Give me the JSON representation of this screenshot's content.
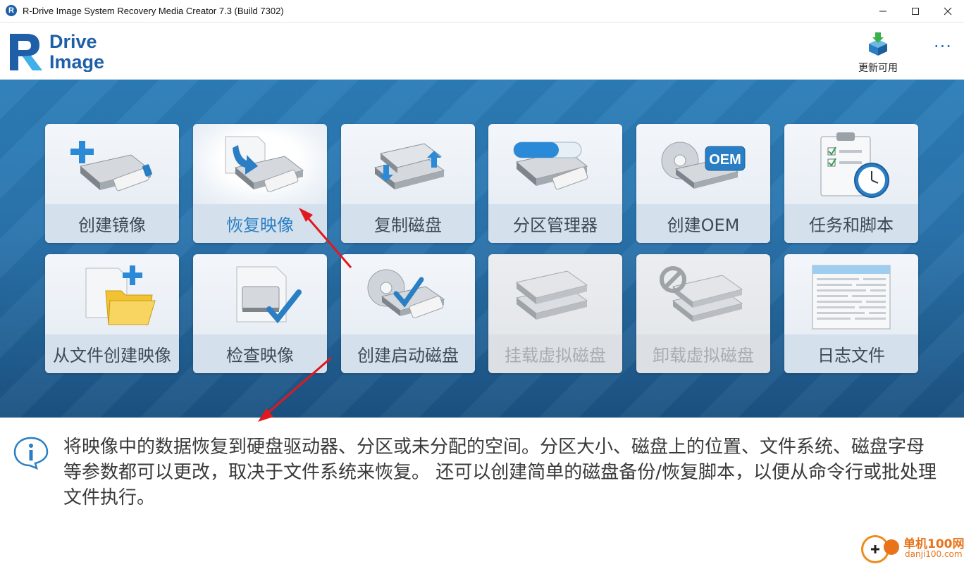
{
  "window": {
    "title": "R-Drive Image System Recovery Media Creator 7.3 (Build 7302)",
    "app_icon_letter": "R"
  },
  "header": {
    "logo_line1": "Drive",
    "logo_line2": "Image",
    "update_label": "更新可用",
    "more_label": "···"
  },
  "tiles": [
    {
      "label": "创建镜像",
      "icon": "create-image-icon"
    },
    {
      "label": "恢复映像",
      "icon": "restore-image-icon"
    },
    {
      "label": "复制磁盘",
      "icon": "copy-disk-icon"
    },
    {
      "label": "分区管理器",
      "icon": "partition-manager-icon"
    },
    {
      "label": "创建OEM",
      "icon": "create-oem-icon"
    },
    {
      "label": "任务和脚本",
      "icon": "tasks-scripts-icon"
    },
    {
      "label": "从文件创建映像",
      "icon": "create-from-files-icon"
    },
    {
      "label": "检查映像",
      "icon": "check-image-icon"
    },
    {
      "label": "创建启动磁盘",
      "icon": "create-boot-disk-icon"
    },
    {
      "label": "挂载虚拟磁盘",
      "icon": "mount-virtual-disk-icon"
    },
    {
      "label": "卸载虚拟磁盘",
      "icon": "unmount-virtual-disk-icon"
    },
    {
      "label": "日志文件",
      "icon": "log-file-icon"
    }
  ],
  "tile_icons": {
    "oem_badge": "OEM"
  },
  "info": {
    "text": "将映像中的数据恢复到硬盘驱动器、分区或未分配的空间。分区大小、磁盘上的位置、文件系统、磁盘字母等参数都可以更改，取决于文件系统来恢复。 还可以创建简单的磁盘备份/恢复脚本，以便从命令行或批处理文件执行。"
  },
  "watermark": {
    "title": "单机100网",
    "url": "danji100.com"
  },
  "colors": {
    "accent": "#2a7fc4",
    "brand": "#1f5fa8",
    "annotation_arrow": "#e0191e"
  }
}
